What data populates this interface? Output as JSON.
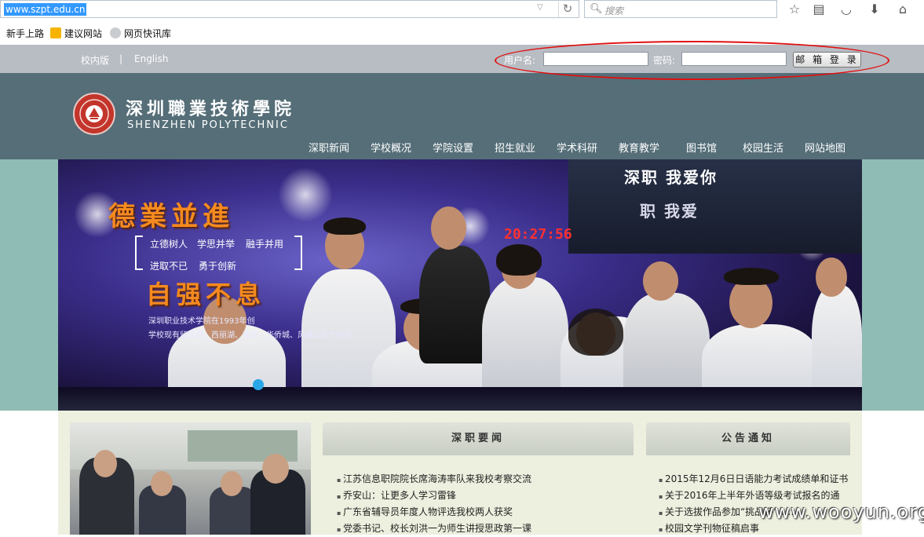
{
  "browser": {
    "url": "www.szpt.edu.cn",
    "search_placeholder": "搜索",
    "bookmarks": [
      "新手上路",
      "建议网站",
      "网页快讯库"
    ]
  },
  "topbar": {
    "campus_link": "校内版",
    "separator": "|",
    "english_link": "English",
    "username_label": "用户名:",
    "password_label": "密码:",
    "mail_login_button": "邮 箱 登 录"
  },
  "header": {
    "logo_cn": "深圳職業技術學院",
    "logo_en": "SHENZHEN POLYTECHNIC",
    "nav": [
      "深职新闻",
      "学校概况",
      "学院设置",
      "招生就业",
      "学术科研",
      "教育教学",
      "图书馆",
      "校园生活",
      "网站地图"
    ]
  },
  "banner": {
    "slogan_top": "德業並進",
    "tagline_line1": [
      "立德树人",
      "学思并举",
      "融手并用"
    ],
    "tagline_line2": [
      "进取不已",
      "勇于创新"
    ],
    "slogan_bottom": "自强不息",
    "desc_line1": "深圳职业技术学院在1993年创",
    "desc_line2": "学校现有留仙洞、西丽湖、官龙、华侨城、风凰山五个校区",
    "screen_text_1": "深职 我爱你",
    "screen_text_2": "职 我爱",
    "clock_text": "20:27:56",
    "slide_count": 1
  },
  "news": {
    "title": "深职要闻",
    "items": [
      "江苏信息职院院长席海涛率队来我校考察交流",
      "乔安山：让更多人学习雷锋",
      "广东省辅导员年度人物评选我校两人获奖",
      "党委书记、校长刘洪一为师生讲授思政第一课"
    ]
  },
  "notices": {
    "title": "公告通知",
    "items": [
      "2015年12月6日日语能力考试成绩单和证书",
      "关于2016年上半年外语等级考试报名的通",
      "关于选拔作品参加“挑战杯”……",
      "校园文学刊物征稿启事"
    ]
  },
  "watermark": "www.wooyun.org",
  "colors": {
    "header_bg": "#556e78",
    "topbar_bg": "#b8bcc3",
    "banner_band": "#8fbcb4",
    "slogan": "#f58a1f",
    "annotation": "#e01010"
  }
}
